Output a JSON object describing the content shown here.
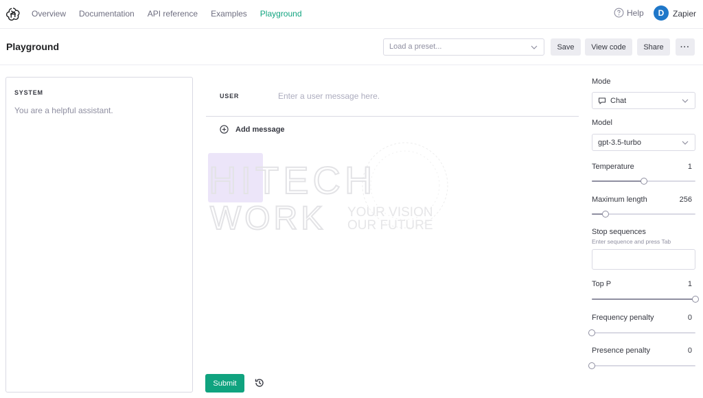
{
  "nav": {
    "links": [
      "Overview",
      "Documentation",
      "API reference",
      "Examples",
      "Playground"
    ],
    "active_index": 4,
    "help_label": "Help",
    "avatar_initial": "D",
    "account_name": "Zapier"
  },
  "header": {
    "title": "Playground",
    "preset_placeholder": "Load a preset...",
    "save_label": "Save",
    "view_code_label": "View code",
    "share_label": "Share",
    "more_label": "···"
  },
  "system": {
    "label": "SYSTEM",
    "text": "You are a helpful assistant."
  },
  "chat": {
    "user_label": "USER",
    "user_placeholder": "Enter a user message here.",
    "add_message_label": "Add message",
    "submit_label": "Submit"
  },
  "watermark": {
    "line1": "HITECH",
    "line2": "WORK",
    "tagline1": "YOUR VISION",
    "tagline2": "OUR FUTURE"
  },
  "settings": {
    "mode_label": "Mode",
    "mode_value": "Chat",
    "model_label": "Model",
    "model_value": "gpt-3.5-turbo",
    "temperature": {
      "label": "Temperature",
      "value": "1",
      "fraction": 0.5
    },
    "max_length": {
      "label": "Maximum length",
      "value": "256",
      "fraction": 0.13
    },
    "stop_sequences": {
      "label": "Stop sequences",
      "hint": "Enter sequence and press Tab"
    },
    "top_p": {
      "label": "Top P",
      "value": "1",
      "fraction": 1.0
    },
    "frequency_penalty": {
      "label": "Frequency penalty",
      "value": "0",
      "fraction": 0.0
    },
    "presence_penalty": {
      "label": "Presence penalty",
      "value": "0",
      "fraction": 0.0
    }
  },
  "colors": {
    "accent": "#10a37f",
    "avatar": "#1f77c9",
    "border": "#d9d9e3"
  }
}
